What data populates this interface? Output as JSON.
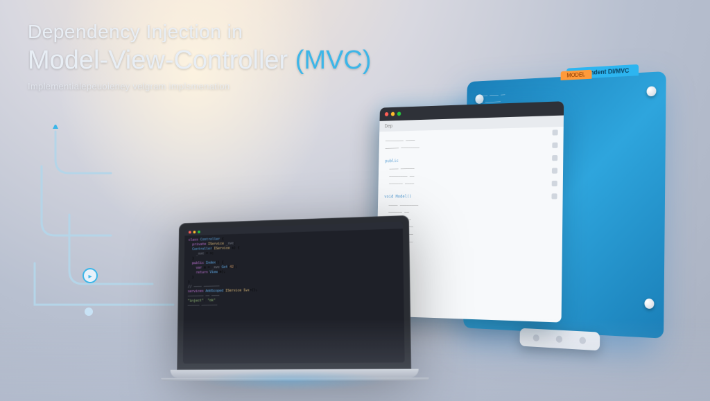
{
  "title": {
    "line1": "Dependency Injection in",
    "line2_a": "Model-View-Controller",
    "line2_b": "(MVC)",
    "subtitle": "Implementialepeuoieney velgram implsmenation"
  },
  "back_panel": {
    "tab1": "Dependent DI/MVC",
    "tab2": "MODEL"
  },
  "front_panel": {
    "tab": "Dep",
    "section1": "public",
    "section2": "void Model()"
  },
  "colors": {
    "accent": "#3db6e8",
    "panel": "#2ea5dd",
    "orange": "#ff9a3a"
  }
}
